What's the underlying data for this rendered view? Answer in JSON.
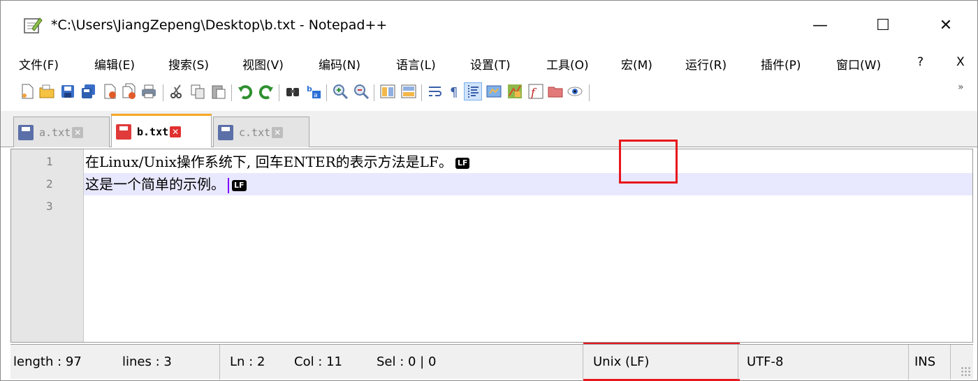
{
  "window": {
    "title": "*C:\\Users\\JiangZepeng\\Desktop\\b.txt - Notepad++",
    "controls": {
      "minimize": "—",
      "maximize": "☐",
      "close": "✕"
    }
  },
  "menu": [
    {
      "label": "文件(F)"
    },
    {
      "label": "编辑(E)"
    },
    {
      "label": "搜索(S)"
    },
    {
      "label": "视图(V)"
    },
    {
      "label": "编码(N)"
    },
    {
      "label": "语言(L)"
    },
    {
      "label": "设置(T)"
    },
    {
      "label": "工具(O)"
    },
    {
      "label": "宏(M)"
    },
    {
      "label": "运行(R)"
    },
    {
      "label": "插件(P)"
    },
    {
      "label": "窗口(W)"
    },
    {
      "label": "?"
    },
    {
      "label": "X"
    }
  ],
  "toolbar": {
    "icons": [
      "new-file-icon",
      "open-file-icon",
      "save-icon",
      "save-all-icon",
      "close-icon",
      "close-all-icon",
      "print-icon",
      "cut-icon",
      "copy-icon",
      "paste-icon",
      "undo-icon",
      "redo-icon",
      "find-icon",
      "replace-icon",
      "zoom-in-icon",
      "zoom-out-icon",
      "sync-vertical-icon",
      "sync-horizontal-icon",
      "word-wrap-icon",
      "show-all-chars-icon",
      "indent-guide-icon",
      "user-lang-icon",
      "doc-map-icon",
      "function-list-icon",
      "folder-workspace-icon",
      "monitor-icon"
    ],
    "overflow": "»"
  },
  "tabs": [
    {
      "label": "a.txt",
      "active": false,
      "color": "#5b6fa8"
    },
    {
      "label": "b.txt",
      "active": true,
      "color": "#e03a3a"
    },
    {
      "label": "c.txt",
      "active": false,
      "color": "#5b6fa8"
    }
  ],
  "editor": {
    "line_numbers": [
      "1",
      "2",
      "3"
    ],
    "lines": [
      {
        "text": "在Linux/Unix操作系统下, 回车ENTER的表示方法是LF。",
        "eol": "LF"
      },
      {
        "text": "这是一个简单的示例。",
        "eol": "LF"
      },
      {
        "text": "",
        "eol": ""
      }
    ],
    "current_line": 2
  },
  "status": {
    "length": "length : 97",
    "lines": "lines : 3",
    "ln": "Ln : 2",
    "col": "Col : 11",
    "sel": "Sel : 0 | 0",
    "eol_format": "Unix (LF)",
    "encoding": "UTF-8",
    "mode": "INS"
  },
  "colors": {
    "annotation": "#e8161b",
    "current_line_bg": "#e8e8ff",
    "active_tab_accent": "#f5a623"
  }
}
